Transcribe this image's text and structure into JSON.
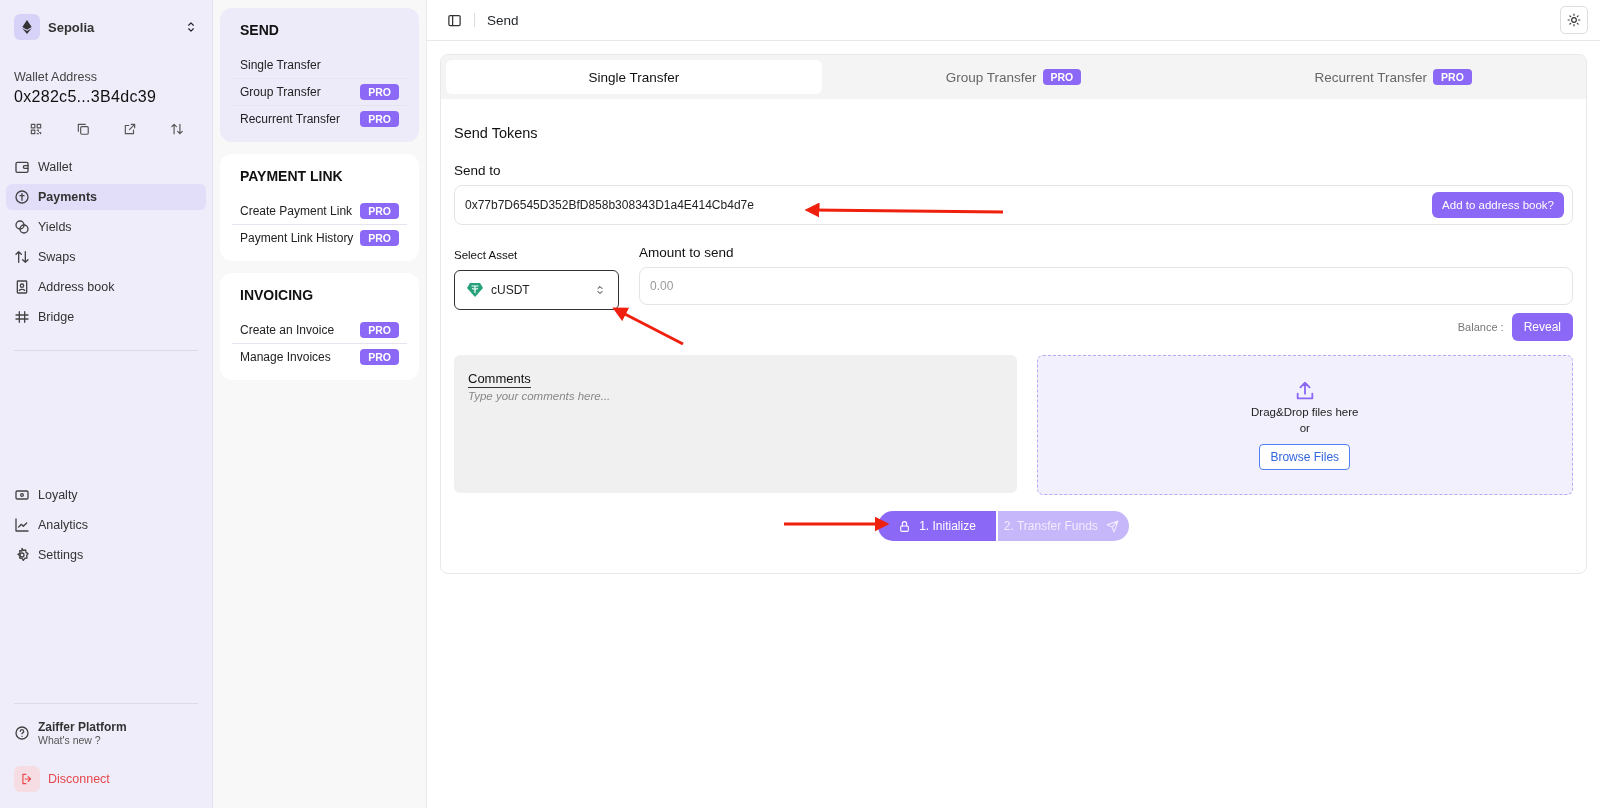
{
  "network": {
    "name": "Sepolia"
  },
  "wallet": {
    "label": "Wallet Address",
    "address": "0x282c5...3B4dc39"
  },
  "nav": [
    {
      "label": "Wallet",
      "selected": false
    },
    {
      "label": "Payments",
      "selected": true
    },
    {
      "label": "Yields",
      "selected": false
    },
    {
      "label": "Swaps",
      "selected": false
    },
    {
      "label": "Address book",
      "selected": false
    },
    {
      "label": "Bridge",
      "selected": false
    }
  ],
  "nav_bottom": [
    {
      "label": "Loyalty",
      "selected": false
    },
    {
      "label": "Analytics",
      "selected": false
    },
    {
      "label": "Settings",
      "selected": false
    }
  ],
  "help": {
    "title": "Zaiffer Platform",
    "subtitle": "What's new ?"
  },
  "disconnect": "Disconnect",
  "menu_sections": [
    {
      "title": "SEND",
      "selected": true,
      "items": [
        {
          "label": "Single Transfer"
        },
        {
          "label": "Group Transfer",
          "badge": "PRO"
        },
        {
          "label": "Recurrent Transfer",
          "badge": "PRO"
        }
      ]
    },
    {
      "title": "PAYMENT LINK",
      "selected": false,
      "items": [
        {
          "label": "Create Payment Link",
          "badge": "PRO"
        },
        {
          "label": "Payment Link History",
          "badge": "PRO"
        }
      ]
    },
    {
      "title": "INVOICING",
      "selected": false,
      "items": [
        {
          "label": "Create an Invoice",
          "badge": "PRO"
        },
        {
          "label": "Manage Invoices",
          "badge": "PRO"
        }
      ]
    }
  ],
  "header": {
    "title": "Send"
  },
  "tabs": [
    {
      "label": "Single Transfer",
      "selected": true
    },
    {
      "label": "Group Transfer",
      "badge": "PRO",
      "selected": false
    },
    {
      "label": "Recurrent Transfer",
      "badge": "PRO",
      "selected": false
    }
  ],
  "form": {
    "title": "Send Tokens",
    "send_to": {
      "label": "Send to",
      "value": "0x77b7D6545D352BfD858b308343D1a4E414Cb4d7e",
      "action": "Add to address book?"
    },
    "asset": {
      "label": "Select Asset",
      "value": "cUSDT"
    },
    "amount": {
      "label": "Amount to send",
      "placeholder": "0.00"
    },
    "balance": {
      "label": "Balance :",
      "action": "Reveal"
    },
    "comments": {
      "label": "Comments",
      "placeholder": "Type your comments here..."
    },
    "upload": {
      "text": "Drag&Drop files here",
      "or": "or",
      "action": "Browse Files"
    },
    "steps": [
      {
        "label": "1. Initialize",
        "disabled": false
      },
      {
        "label": "2. Transfer Funds",
        "disabled": true
      }
    ]
  }
}
